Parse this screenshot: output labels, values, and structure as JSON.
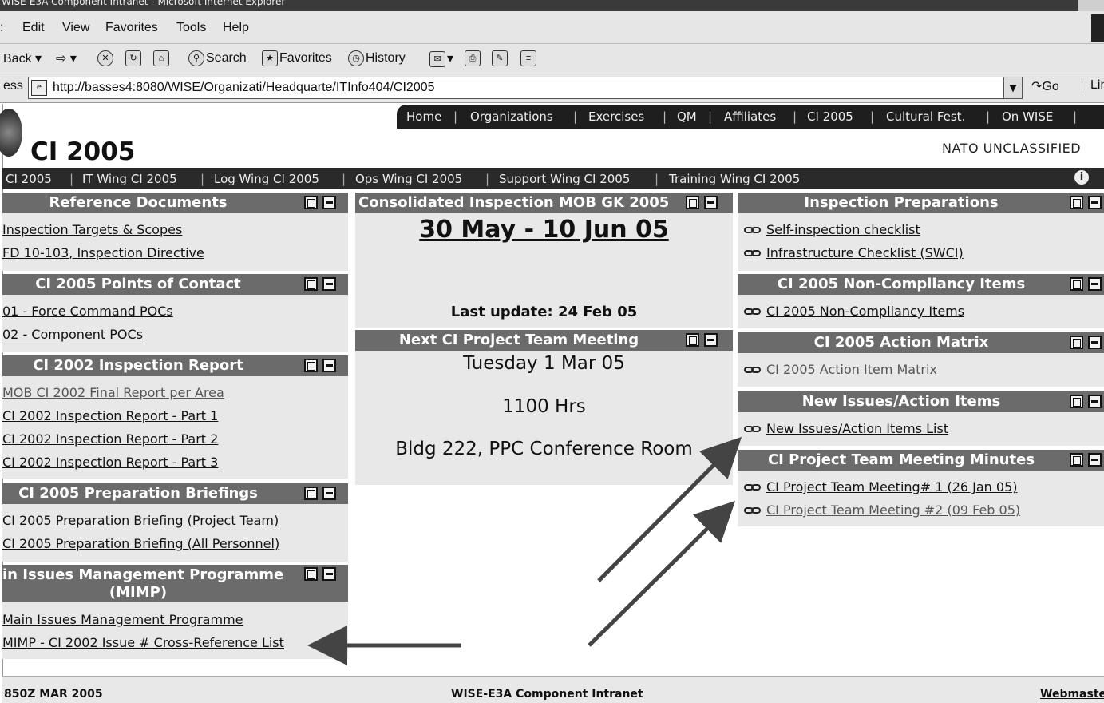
{
  "browser": {
    "title": "WISE-E3A Component Intranet - Microsoft Internet Explorer",
    "menu": [
      "Edit",
      "View",
      "Favorites",
      "Tools",
      "Help"
    ],
    "menu_first_partial": ":",
    "toolbar": {
      "back": "Back",
      "search": "Search",
      "favorites": "Favorites",
      "history": "History"
    },
    "address_label": "ess",
    "address_url": "http://basses4:8080/WISE/Organizati/Headquarte/ITInfo404/CI2005",
    "go": "Go",
    "links": "Lin"
  },
  "topnav": [
    "Home",
    "Organizations",
    "Exercises",
    "QM",
    "Affiliates",
    "CI 2005",
    "Cultural Fest.",
    "On WISE"
  ],
  "page_title": "CI 2005",
  "classification": "NATO UNCLASSIFIED",
  "subnav": [
    "CI 2005",
    "IT Wing CI 2005",
    "Log Wing CI 2005",
    "Ops Wing CI 2005",
    "Support Wing CI 2005",
    "Training Wing CI 2005"
  ],
  "left": {
    "ref_docs": {
      "title": "Reference Documents",
      "links": [
        "Inspection Targets & Scopes",
        "FD 10-103, Inspection Directive"
      ]
    },
    "poc": {
      "title": "CI 2005 Points of Contact",
      "links": [
        "01 - Force Command POCs",
        "02 - Component POCs"
      ]
    },
    "report2002": {
      "title": "CI 2002 Inspection Report",
      "links": [
        "MOB CI 2002 Final Report per Area",
        "CI 2002 Inspection Report - Part 1",
        "CI 2002 Inspection Report - Part 2",
        "CI 2002 Inspection Report - Part 3"
      ]
    },
    "briefings": {
      "title": "CI 2005 Preparation Briefings",
      "links": [
        "CI 2005 Preparation Briefing (Project Team)",
        "CI 2005 Preparation Briefing (All Personnel)"
      ]
    },
    "mimp": {
      "title_line1": "in Issues Management Programme",
      "title_line2": "(MIMP)",
      "links": [
        "Main Issues Management Programme",
        "MIMP - CI 2002 Issue # Cross-Reference List"
      ]
    }
  },
  "center": {
    "consolidated": {
      "title": "Consolidated Inspection MOB GK 2005",
      "dates": "30 May - 10 Jun 05",
      "last_update": "Last update: 24 Feb 05"
    },
    "meeting": {
      "title": "Next CI Project Team Meeting",
      "day": "Tuesday 1 Mar 05",
      "time": "1100 Hrs",
      "place": "Bldg 222, PPC Conference Room"
    }
  },
  "right": {
    "prep": {
      "title": "Inspection Preparations",
      "links": [
        "Self-inspection checklist",
        "Infrastructure Checklist (SWCI)"
      ]
    },
    "noncomp": {
      "title": "CI 2005 Non-Compliancy Items",
      "links": [
        "CI 2005 Non-Compliancy Items"
      ]
    },
    "matrix": {
      "title": "CI 2005 Action Matrix",
      "links": [
        "CI 2005 Action Item Matrix"
      ]
    },
    "newissues": {
      "title": "New Issues/Action Items",
      "links": [
        "New Issues/Action Items List"
      ]
    },
    "minutes": {
      "title": "CI Project Team Meeting Minutes",
      "links": [
        "CI Project Team Meeting# 1 (26 Jan 05)",
        "CI Project Team Meeting #2 (09 Feb 05)"
      ]
    }
  },
  "footer": {
    "left": "850Z MAR 2005",
    "center": "WISE-E3A Component Intranet",
    "right": "Webmaster"
  },
  "colors": {
    "header_grey": "#6b6b6b",
    "nav_dark": "#1e1e1e",
    "panel_bg": "#e8e8e8"
  }
}
